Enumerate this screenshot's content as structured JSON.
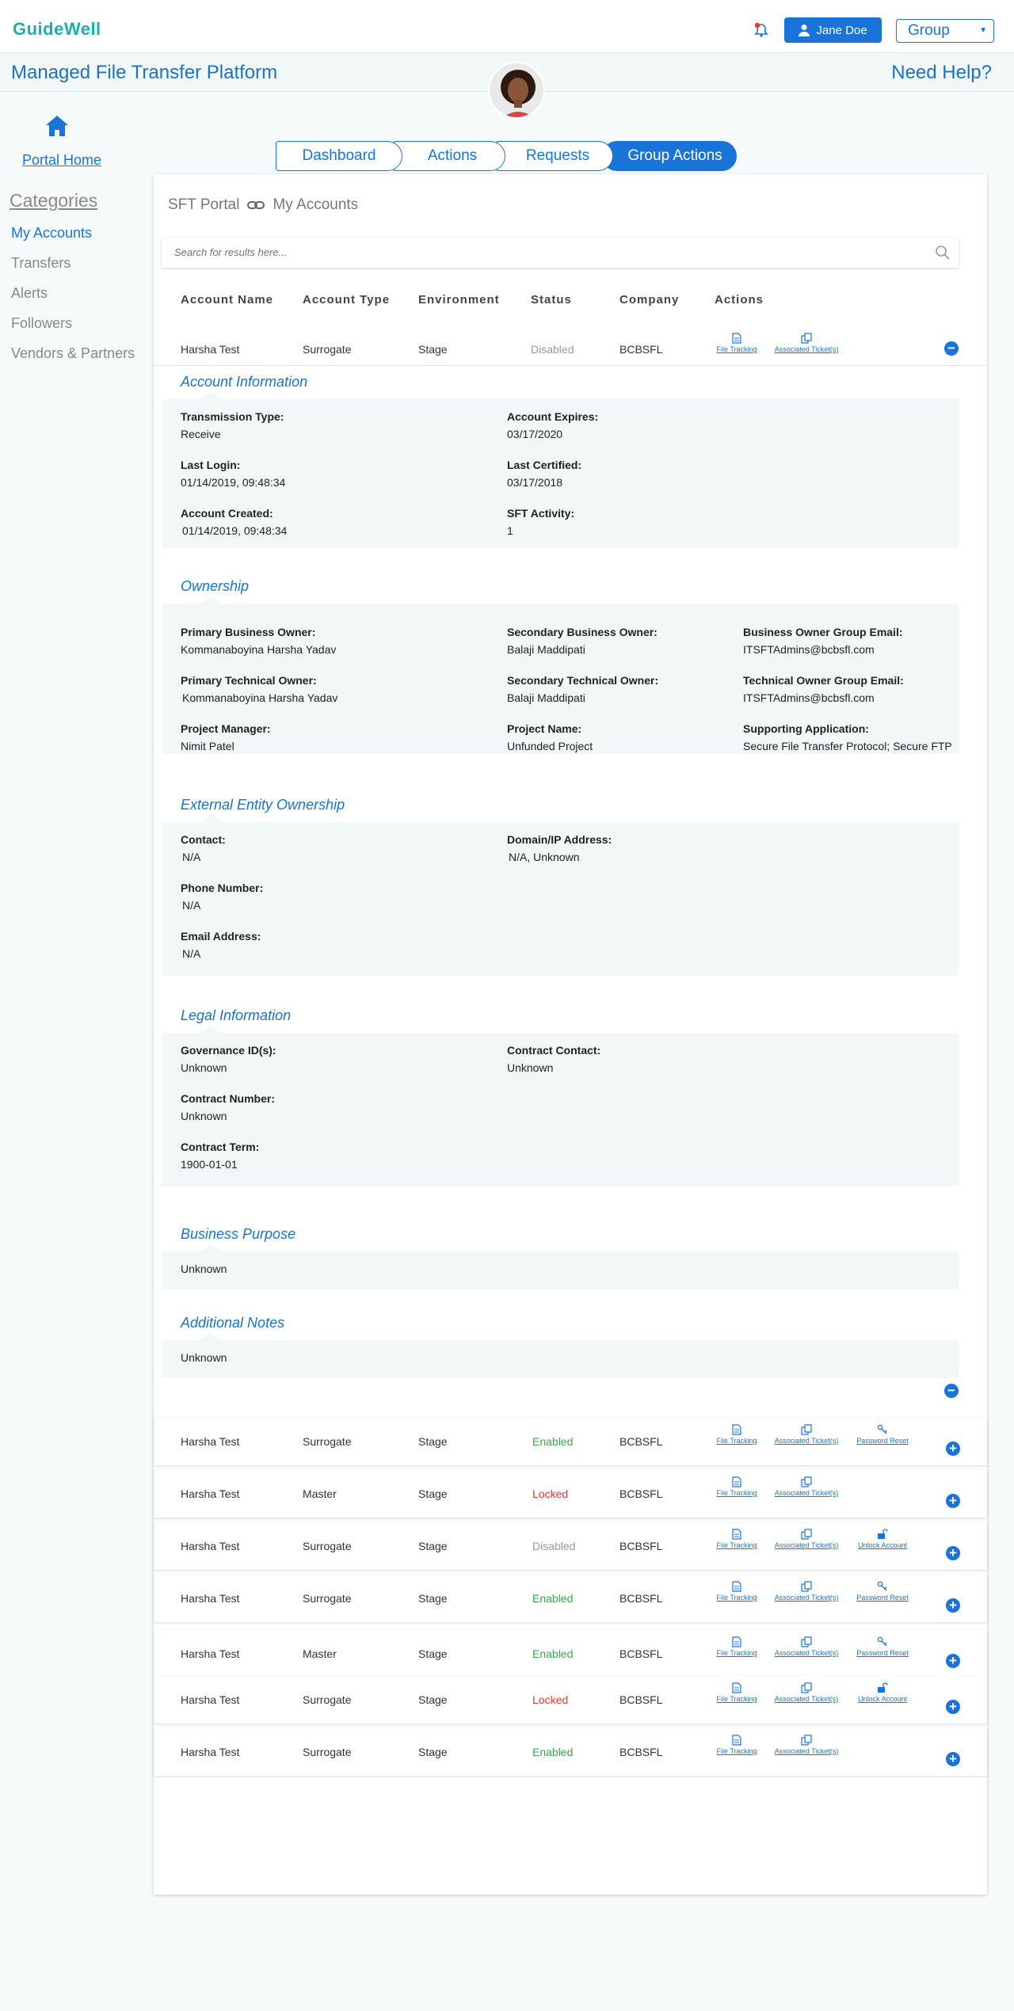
{
  "header": {
    "logo": "GuideWell",
    "user_name": "Jane Doe",
    "group_select": "Group",
    "app_title": "Managed File Transfer Platform",
    "help": "Need Help?"
  },
  "sidebar": {
    "home_label": "Portal Home",
    "categories_title": "Categories",
    "items": [
      "My Accounts",
      "Transfers",
      "Alerts",
      "Followers",
      "Vendors & Partners"
    ]
  },
  "tabs": [
    "Dashboard",
    "Actions",
    "Requests",
    "Group Actions"
  ],
  "breadcrumb": {
    "root": "SFT Portal",
    "current": "My Accounts"
  },
  "search": {
    "placeholder": "Search for results here..."
  },
  "columns": [
    "Account Name",
    "Account Type",
    "Environment",
    "Status",
    "Company",
    "Actions"
  ],
  "expanded_row": {
    "name": "Harsha Test",
    "type": "Surrogate",
    "env": "Stage",
    "status": "Disabled",
    "company": "BCBSFL",
    "actions": [
      "File Tracking",
      "Associated Ticket(s)"
    ]
  },
  "sections": {
    "account_info": {
      "title": "Account Information",
      "transmission_type_label": "Transmission Type:",
      "transmission_type": "Receive",
      "last_login_label": "Last Login:",
      "last_login": "01/14/2019, 09:48:34",
      "account_created_label": "Account Created:",
      "account_created": "01/14/2019, 09:48:34",
      "account_expires_label": "Account Expires:",
      "account_expires": "03/17/2020",
      "last_certified_label": "Last Certified:",
      "last_certified": "03/17/2018",
      "sft_activity_label": "SFT Activity:",
      "sft_activity": "1"
    },
    "ownership": {
      "title": "Ownership",
      "pbo_label": "Primary Business Owner:",
      "pbo": "Kommanaboyina Harsha Yadav",
      "pto_label": "Primary Technical Owner:",
      "pto": "Kommanaboyina Harsha Yadav",
      "pm_label": "Project Manager:",
      "pm": "Nimit Patel",
      "sbo_label": "Secondary Business Owner:",
      "sbo": "Balaji Maddipati",
      "sto_label": "Secondary Technical Owner:",
      "sto": "Balaji Maddipati",
      "pn_label": "Project Name:",
      "pn": "Unfunded Project",
      "bog_label": "Business Owner Group Email:",
      "bog": "ITSFTAdmins@bcbsfl.com",
      "tog_label": "Technical Owner Group Email:",
      "tog": "ITSFTAdmins@bcbsfl.com",
      "sa_label": "Supporting Application:",
      "sa": "Secure File Transfer Protocol; Secure FTP"
    },
    "external": {
      "title": "External Entity Ownership",
      "contact_label": "Contact:",
      "contact": "N/A",
      "phone_label": "Phone Number:",
      "phone": "N/A",
      "email_label": "Email Address:",
      "email": "N/A",
      "domain_label": "Domain/IP Address:",
      "domain": "N/A, Unknown"
    },
    "legal": {
      "title": "Legal Information",
      "gov_label": "Governance ID(s):",
      "gov": "Unknown",
      "cnum_label": "Contract Number:",
      "cnum": "Unknown",
      "cterm_label": "Contract Term:",
      "cterm": "1900-01-01",
      "ccontact_label": "Contract Contact:",
      "ccontact": "Unknown"
    },
    "purpose": {
      "title": "Business Purpose",
      "value": "Unknown"
    },
    "notes": {
      "title": "Additional Notes",
      "value": "Unknown"
    }
  },
  "rows": [
    {
      "name": "Harsha Test",
      "type": "Surrogate",
      "env": "Stage",
      "status": "Enabled",
      "company": "BCBSFL",
      "actions": [
        "File Tracking",
        "Associated Ticket(s)",
        "Password Reset"
      ]
    },
    {
      "name": "Harsha Test",
      "type": "Master",
      "env": "Stage",
      "status": "Locked",
      "company": "BCBSFL",
      "actions": [
        "File Tracking",
        "Associated Ticket(s)"
      ]
    },
    {
      "name": "Harsha Test",
      "type": "Surrogate",
      "env": "Stage",
      "status": "Disabled",
      "company": "BCBSFL",
      "actions": [
        "File Tracking",
        "Associated Ticket(s)",
        "Unlock Account"
      ]
    },
    {
      "name": "Harsha Test",
      "type": "Surrogate",
      "env": "Stage",
      "status": "Enabled",
      "company": "BCBSFL",
      "actions": [
        "File Tracking",
        "Associated Ticket(s)",
        "Password Reset"
      ]
    },
    {
      "name": "Harsha Test",
      "type": "Master",
      "env": "Stage",
      "status": "Enabled",
      "company": "BCBSFL",
      "actions": [
        "File Tracking",
        "Associated Ticket(s)",
        "Password Reset"
      ]
    },
    {
      "name": "Harsha Test",
      "type": "Surrogate",
      "env": "Stage",
      "status": "Locked",
      "company": "BCBSFL",
      "actions": [
        "File Tracking",
        "Associated Ticket(s)",
        "Unlock Account"
      ]
    },
    {
      "name": "Harsha Test",
      "type": "Surrogate",
      "env": "Stage",
      "status": "Enabled",
      "company": "BCBSFL",
      "actions": [
        "File Tracking",
        "Associated Ticket(s)"
      ]
    }
  ]
}
